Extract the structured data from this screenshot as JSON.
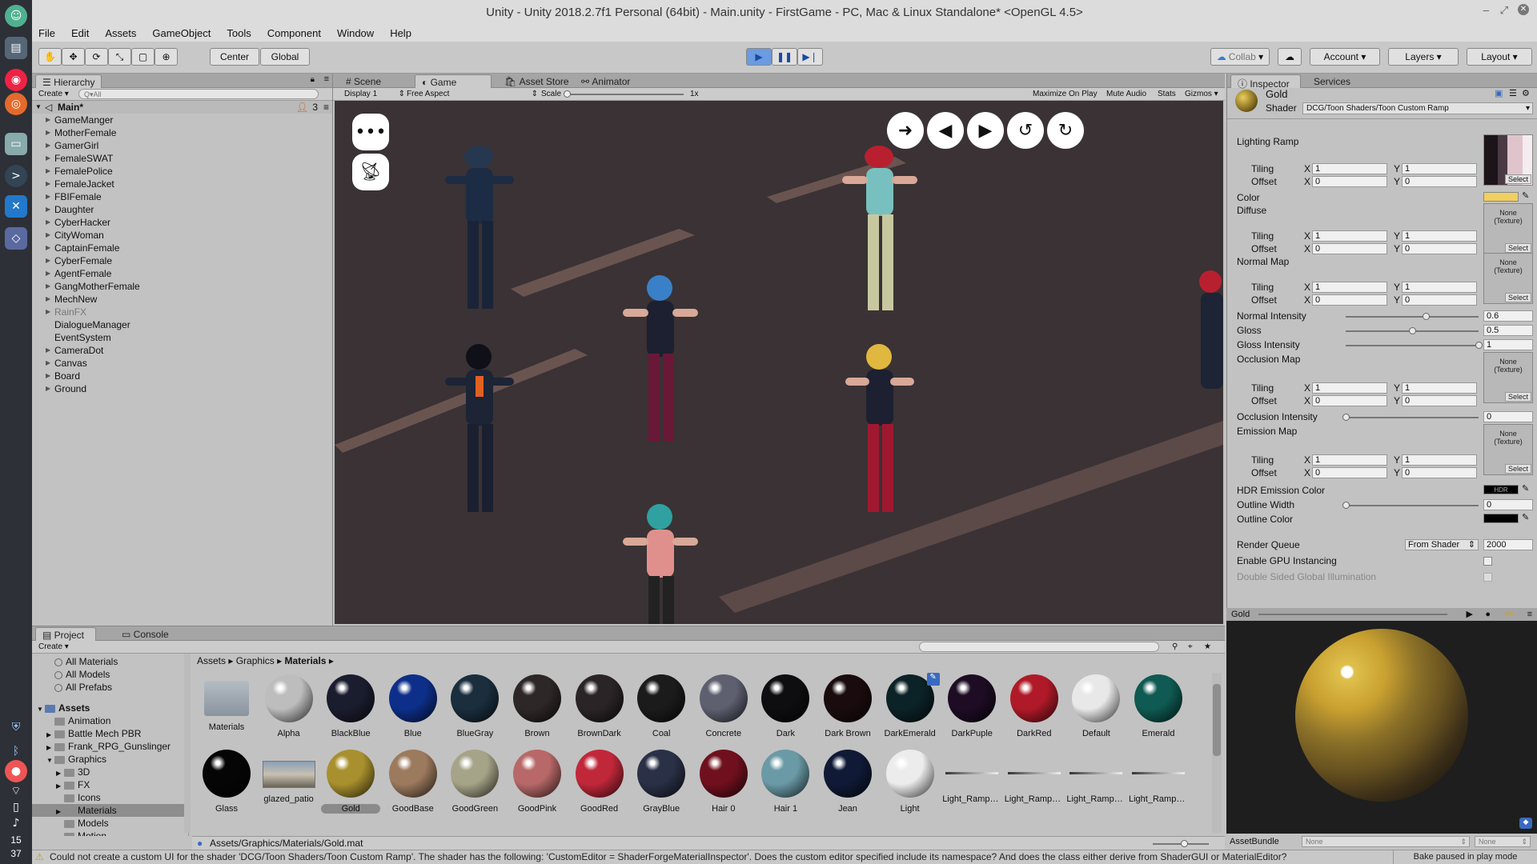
{
  "window": {
    "title": "Unity - Unity 2018.2.7f1 Personal (64bit) - Main.unity - FirstGame - PC, Mac & Linux Standalone* <OpenGL 4.5>"
  },
  "dock": {
    "clock_hour": "15",
    "clock_min": "37"
  },
  "menu": [
    "File",
    "Edit",
    "Assets",
    "GameObject",
    "Tools",
    "Component",
    "Window",
    "Help"
  ],
  "toolbar": {
    "center": "Center",
    "global": "Global",
    "collab": "Collab",
    "account": "Account",
    "layers": "Layers",
    "layout": "Layout"
  },
  "hierarchy": {
    "tab": "Hierarchy",
    "create": "Create",
    "search_placeholder": "Q▾All",
    "scene": "Main*",
    "badge": "3",
    "items": [
      {
        "label": "GameManger",
        "arrow": true
      },
      {
        "label": "MotherFemale",
        "arrow": true
      },
      {
        "label": "GamerGirl",
        "arrow": true
      },
      {
        "label": "FemaleSWAT",
        "arrow": true
      },
      {
        "label": "FemalePolice",
        "arrow": true
      },
      {
        "label": "FemaleJacket",
        "arrow": true
      },
      {
        "label": "FBIFemale",
        "arrow": true
      },
      {
        "label": "Daughter",
        "arrow": true
      },
      {
        "label": "CyberHacker",
        "arrow": true
      },
      {
        "label": "CityWoman",
        "arrow": true
      },
      {
        "label": "CaptainFemale",
        "arrow": true
      },
      {
        "label": "CyberFemale",
        "arrow": true
      },
      {
        "label": "AgentFemale",
        "arrow": true
      },
      {
        "label": "GangMotherFemale",
        "arrow": true
      },
      {
        "label": "MechNew",
        "arrow": true
      },
      {
        "label": "RainFX",
        "arrow": true,
        "dim": true
      },
      {
        "label": "DialogueManager",
        "arrow": false
      },
      {
        "label": "EventSystem",
        "arrow": false
      },
      {
        "label": "CameraDot",
        "arrow": true
      },
      {
        "label": "Canvas",
        "arrow": true
      },
      {
        "label": "Board",
        "arrow": true
      },
      {
        "label": "Ground",
        "arrow": true
      }
    ]
  },
  "viewtabs": {
    "scene": "Scene",
    "game": "Game",
    "asset_store": "Asset Store",
    "animator": "Animator"
  },
  "gamebar": {
    "display": "Display 1",
    "aspect": "Free Aspect",
    "scale_label": "Scale",
    "scale_value": "1x",
    "maximize": "Maximize On Play",
    "mute": "Mute Audio",
    "stats": "Stats",
    "gizmos": "Gizmos"
  },
  "inspector": {
    "tab": "Inspector",
    "services": "Services",
    "material": "Gold",
    "shader_label": "Shader",
    "shader": "DCG/Toon Shaders/Toon Custom Ramp",
    "lighting_ramp": "Lighting Ramp",
    "tiling": "Tiling",
    "offset": "Offset",
    "x": "X",
    "y": "Y",
    "one": "1",
    "zero": "0",
    "color": "Color",
    "diffuse": "Diffuse",
    "normal_map": "Normal Map",
    "normal_intensity": "Normal Intensity",
    "normal_intensity_val": "0.6",
    "gloss": "Gloss",
    "gloss_val": "0.5",
    "gloss_intensity": "Gloss Intensity",
    "gloss_intensity_val": "1",
    "occlusion_map": "Occlusion Map",
    "occlusion_intensity": "Occlusion Intensity",
    "occlusion_intensity_val": "0",
    "emission_map": "Emission Map",
    "hdr_emission": "HDR Emission Color",
    "hdr": "HDR",
    "outline_width": "Outline Width",
    "outline_width_val": "0",
    "outline_color": "Outline Color",
    "render_queue": "Render Queue",
    "render_queue_mode": "From Shader",
    "render_queue_val": "2000",
    "gpu_instancing": "Enable GPU Instancing",
    "double_sided": "Double Sided Global Illumination",
    "none_texture_1": "None",
    "none_texture_2": "(Texture)",
    "select": "Select",
    "normal_intensity_level": 0.6,
    "gloss_level": 0.5,
    "gloss_intensity_level": 1.0,
    "occlusion_level": 0.0,
    "outline_level": 0.0
  },
  "preview": {
    "title": "Gold",
    "assetbundle": "AssetBundle",
    "none1": "None",
    "none2": "None"
  },
  "project": {
    "tab": "Project",
    "console": "Console",
    "create": "Create",
    "favorites": [
      "All Materials",
      "All Models",
      "All Prefabs"
    ],
    "tree": [
      {
        "label": "Assets",
        "indent": 0,
        "arrow": "▼"
      },
      {
        "label": "Animation",
        "indent": 1,
        "arrow": ""
      },
      {
        "label": "Battle Mech PBR",
        "indent": 1,
        "arrow": "▶"
      },
      {
        "label": "Frank_RPG_Gunslinger",
        "indent": 1,
        "arrow": "▶"
      },
      {
        "label": "Graphics",
        "indent": 1,
        "arrow": "▼"
      },
      {
        "label": "3D",
        "indent": 2,
        "arrow": "▶"
      },
      {
        "label": "FX",
        "indent": 2,
        "arrow": "▶"
      },
      {
        "label": "Icons",
        "indent": 2,
        "arrow": ""
      },
      {
        "label": "Materials",
        "indent": 2,
        "arrow": "▶",
        "sel": true
      },
      {
        "label": "Models",
        "indent": 2,
        "arrow": ""
      },
      {
        "label": "Motion",
        "indent": 2,
        "arrow": ""
      }
    ],
    "breadcrumb": [
      "Assets",
      "Graphics",
      "Materials"
    ],
    "path": "Assets/Graphics/Materials/Gold.mat",
    "row1": [
      {
        "label": "Materials",
        "c": "folder"
      },
      {
        "label": "Alpha",
        "c": "#bdbdbd"
      },
      {
        "label": "BlackBlue",
        "c": "#1a1d2e"
      },
      {
        "label": "Blue",
        "c": "#0d2f8a"
      },
      {
        "label": "BlueGray",
        "c": "#1a2e3e"
      },
      {
        "label": "Brown",
        "c": "#2e2728"
      },
      {
        "label": "BrownDark",
        "c": "#2a2426"
      },
      {
        "label": "Coal",
        "c": "#1c1b1c"
      },
      {
        "label": "Concrete",
        "c": "#5e6070"
      },
      {
        "label": "Dark",
        "c": "#0e0e10"
      },
      {
        "label": "Dark Brown",
        "c": "#1a0c0e"
      },
      {
        "label": "DarkEmerald",
        "c": "#0b2226"
      },
      {
        "label": "DarkPuple",
        "c": "#1e0c24"
      },
      {
        "label": "DarkRed",
        "c": "#b01a28"
      },
      {
        "label": "Default",
        "c": "#e8e8e8"
      },
      {
        "label": "Emerald",
        "c": "#0f5a52"
      }
    ],
    "row2": [
      {
        "label": "Glass",
        "c": "#050505"
      },
      {
        "label": "glazed_patio",
        "c": "photo"
      },
      {
        "label": "Gold",
        "c": "#a8902e",
        "sel": true
      },
      {
        "label": "GoodBase",
        "c": "#9c7a5e"
      },
      {
        "label": "GoodGreen",
        "c": "#a6a488"
      },
      {
        "label": "GoodPink",
        "c": "#b86868"
      },
      {
        "label": "GoodRed",
        "c": "#c0283a"
      },
      {
        "label": "GrayBlue",
        "c": "#2a3046"
      },
      {
        "label": "Hair 0",
        "c": "#70101e"
      },
      {
        "label": "Hair 1",
        "c": "#6a9aa6"
      },
      {
        "label": "Jean",
        "c": "#101a36"
      },
      {
        "label": "Light",
        "c": "#ececec"
      },
      {
        "label": "Light_Ramp_...",
        "c": "ramp"
      },
      {
        "label": "Light_Ramp_...",
        "c": "ramp"
      },
      {
        "label": "Light_Ramp_...",
        "c": "ramp"
      },
      {
        "label": "Light_Ramp_...",
        "c": "ramp"
      }
    ]
  },
  "status": {
    "message": "Could not create a custom UI for the shader 'DCG/Toon Shaders/Toon Custom Ramp'. The shader has the following: 'CustomEditor = ShaderForgeMaterialInspector'. Does the custom editor specified include its namespace? And does the class either derive from ShaderGUI or MaterialEditor?",
    "bake": "Bake paused in play mode"
  },
  "colors": {
    "accent": "#3d7bd6",
    "gold": "#a8902e",
    "game_bg": "#3a3234"
  }
}
